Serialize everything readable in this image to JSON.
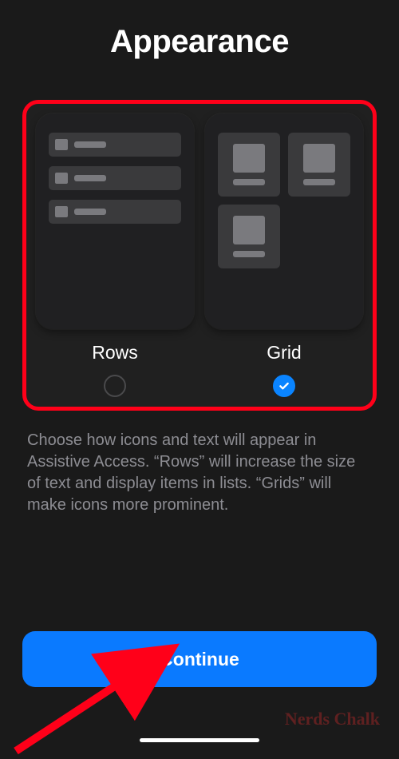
{
  "title": "Appearance",
  "options": {
    "rows": {
      "label": "Rows",
      "selected": false
    },
    "grid": {
      "label": "Grid",
      "selected": true
    }
  },
  "description": "Choose how icons and text will appear in Assistive Access. “Rows” will increase the size of text and display items in lists. “Grids” will make icons more prominent.",
  "continue_label": "Continue",
  "watermark": "Nerds Chalk"
}
